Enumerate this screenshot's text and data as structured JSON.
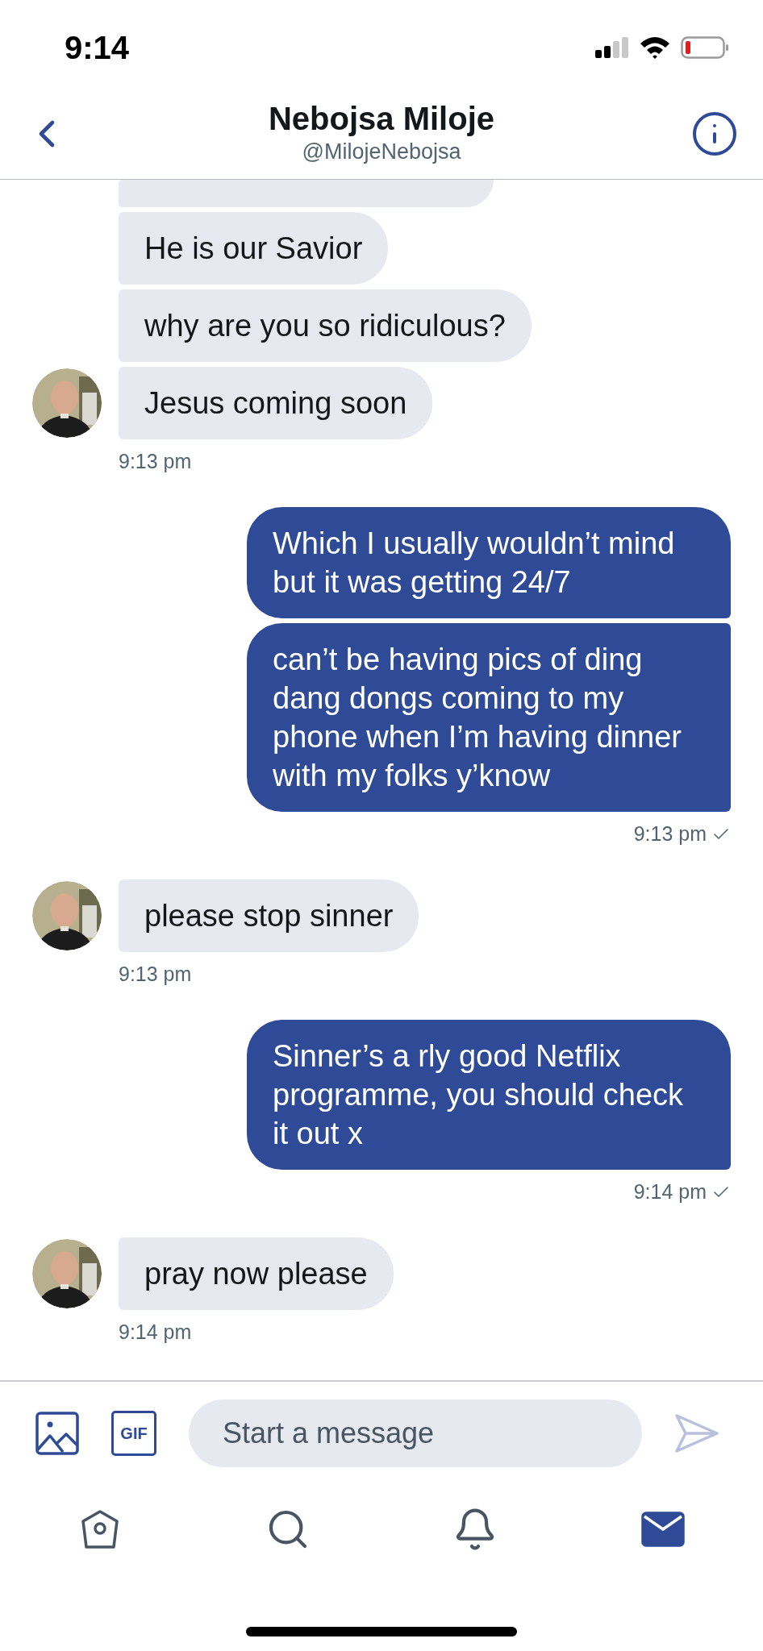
{
  "status_bar": {
    "time": "9:14"
  },
  "header": {
    "name": "Nebojsa Miloje",
    "handle": "@MilojeNebojsa"
  },
  "groups": [
    {
      "kind": "received",
      "cut_bubble": true,
      "messages": [
        "He is our Savior",
        "why are you so ridiculous?",
        "Jesus coming soon"
      ],
      "time": "9:13 pm",
      "seen": false
    },
    {
      "kind": "sent",
      "cut_bubble": false,
      "messages": [
        "Which I usually wouldn’t mind but it was getting 24/7",
        "can’t be having pics of ding dang dongs coming to my phone when I’m having dinner with my folks y’know"
      ],
      "time": "9:13 pm",
      "seen": true
    },
    {
      "kind": "received",
      "cut_bubble": false,
      "messages": [
        "please stop sinner"
      ],
      "time": "9:13 pm",
      "seen": false
    },
    {
      "kind": "sent",
      "cut_bubble": false,
      "messages": [
        "Sinner’s a rly good Netflix programme, you should check it out x"
      ],
      "time": "9:14 pm",
      "seen": true
    },
    {
      "kind": "received",
      "cut_bubble": false,
      "messages": [
        "pray now please"
      ],
      "time": "9:14 pm",
      "seen": false
    }
  ],
  "composer": {
    "gif_label": "GIF",
    "placeholder": "Start a message"
  },
  "tabs": [
    {
      "kind": "home",
      "selected": false
    },
    {
      "kind": "search",
      "selected": false
    },
    {
      "kind": "notifications",
      "selected": false
    },
    {
      "kind": "messages",
      "selected": true
    }
  ]
}
